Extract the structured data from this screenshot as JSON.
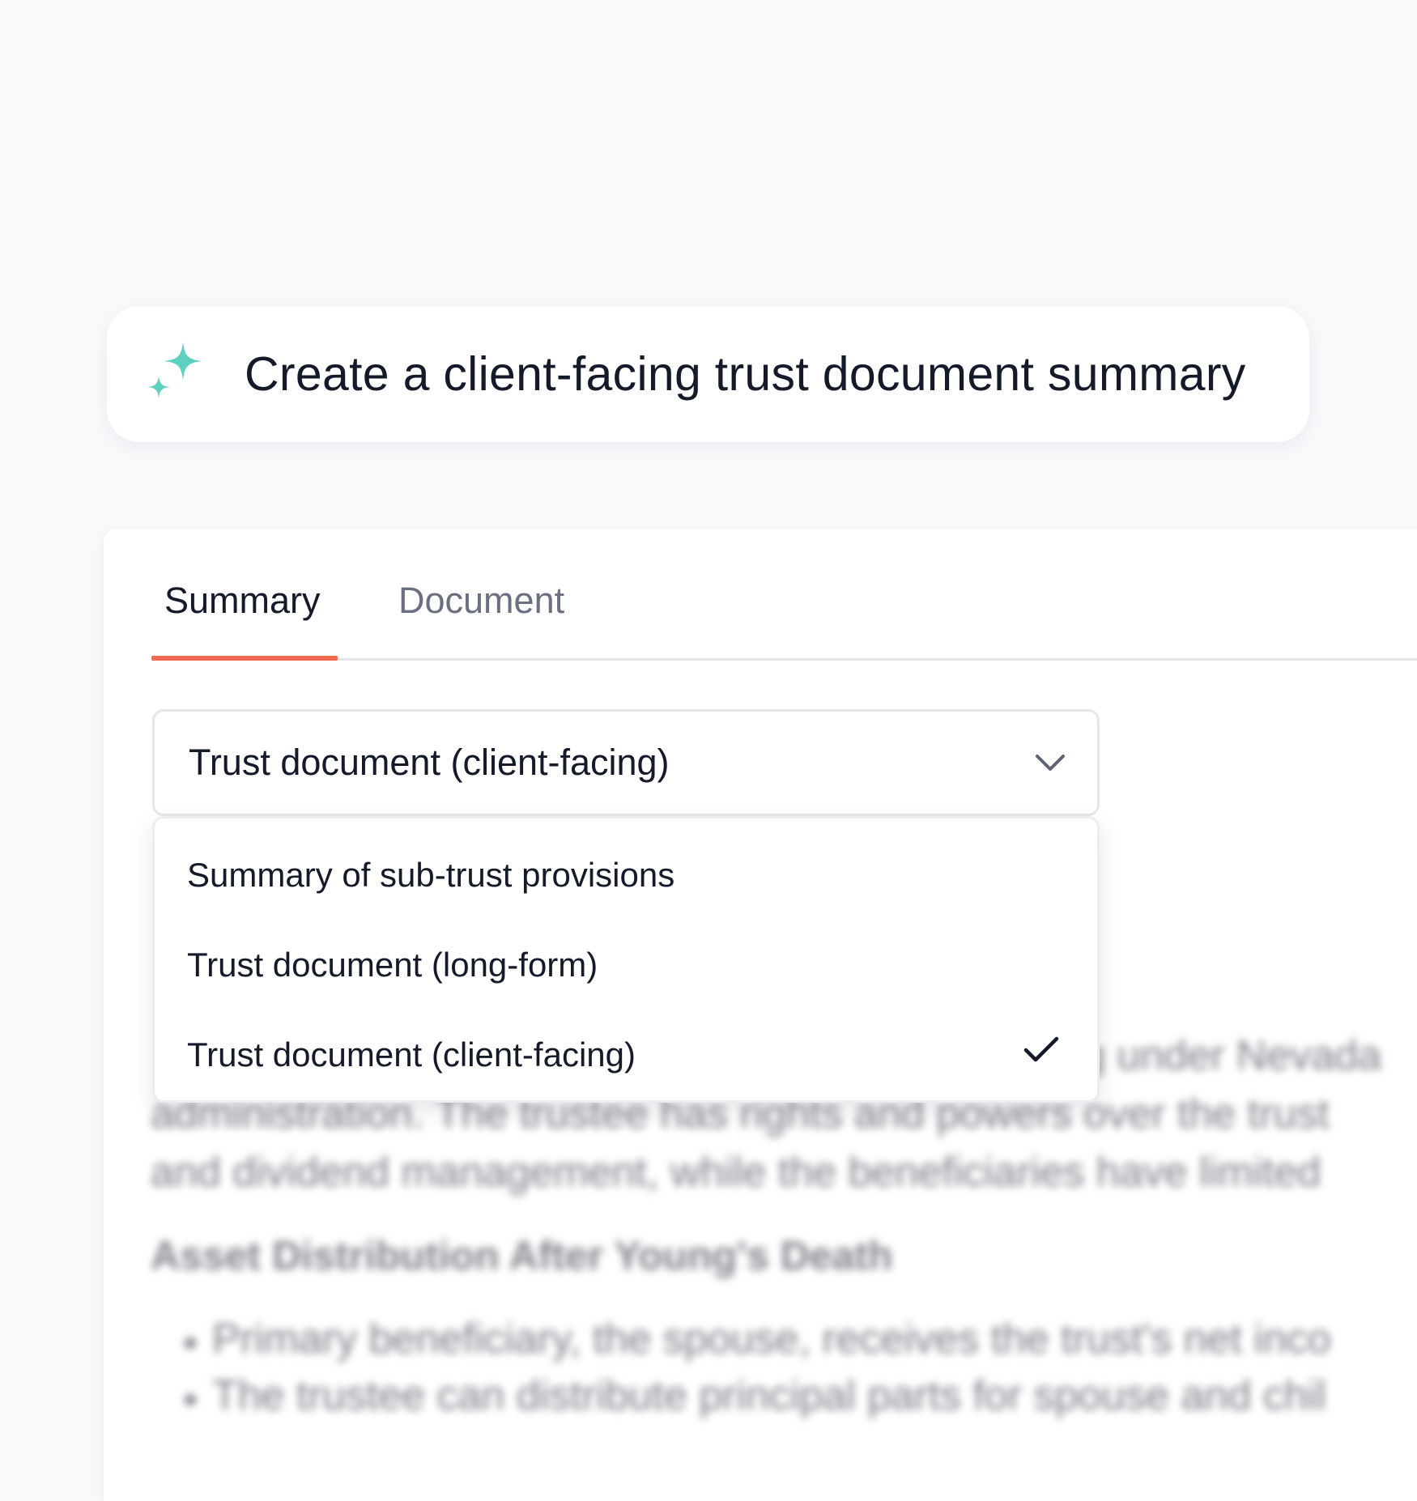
{
  "prompt": {
    "icon": "sparkle-icon",
    "accent_color": "#5fd0c0",
    "text": "Create a client-facing trust document summary"
  },
  "tabs": [
    {
      "label": "Summary",
      "active": true
    },
    {
      "label": "Document",
      "active": false
    }
  ],
  "tab_accent_color": "#f2684e",
  "select": {
    "value": "Trust document (client-facing)",
    "icon": "chevron-down-icon"
  },
  "menu": {
    "options": [
      {
        "label": "Summary of sub-trust provisions",
        "selected": false
      },
      {
        "label": "Trust document (long-form)",
        "selected": false
      },
      {
        "label": "Trust document (client-facing)",
        "selected": true
      }
    ],
    "selected_icon": "check-icon"
  },
  "background_content": {
    "line1_tail": "g under Nevada",
    "line2": "administration. The trustee has rights and powers over the trust",
    "line3": "and dividend management, while the beneficiaries have limited",
    "heading": "Asset Distribution After Young's Death",
    "bullets": [
      "Primary beneficiary, the spouse, receives the trust's net inco",
      "The trustee can distribute principal parts for spouse and chil"
    ]
  }
}
